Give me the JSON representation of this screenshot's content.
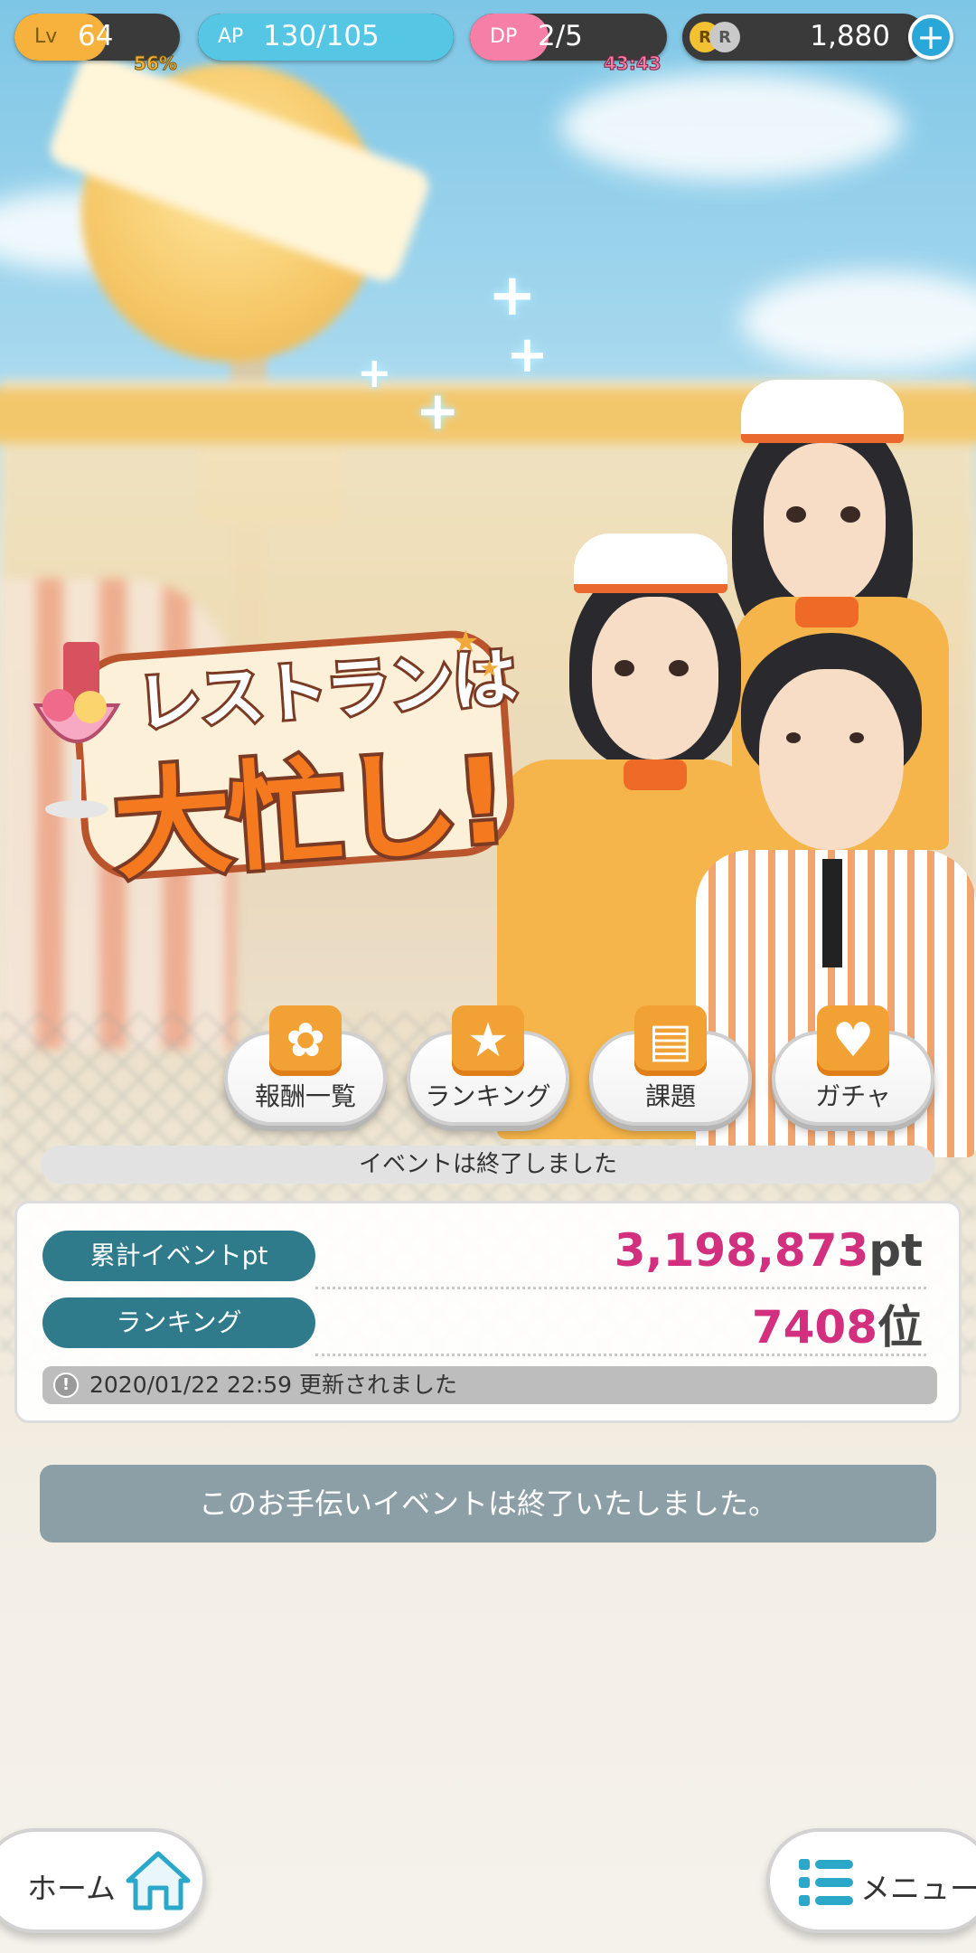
{
  "status_bar": {
    "level_tag": "Lv",
    "level_value": "64",
    "level_progress": "56%",
    "ap_tag": "AP",
    "ap_value": "130/105",
    "dp_tag": "DP",
    "dp_value": "2/5",
    "dp_timer": "43:43",
    "coin_r1": "R",
    "coin_r2": "R",
    "currency_value": "1,880",
    "add_button_symbol": "+"
  },
  "event_logo": {
    "line1": "レストランは",
    "line2": "大忙し!"
  },
  "event_buttons": [
    {
      "label": "報酬一覧",
      "icon": "gift-icon"
    },
    {
      "label": "ランキング",
      "icon": "trophy-icon"
    },
    {
      "label": "課題",
      "icon": "notebook-icon"
    },
    {
      "label": "ガチャ",
      "icon": "heart-card-icon"
    }
  ],
  "event_status": {
    "ended_banner": "イベントは終了しました",
    "stats": [
      {
        "label": "累計イベントpt",
        "value": "3,198,873",
        "unit": "pt"
      },
      {
        "label": "ランキング",
        "value": "7408",
        "unit": "位"
      }
    ],
    "updated_text": "2020/01/22 22:59 更新されました",
    "info_symbol": "!"
  },
  "ended_message": "このお手伝いイベントは終了いたしました。",
  "bottom_nav": {
    "home_label": "ホーム",
    "menu_label": "メニュー"
  },
  "colors": {
    "level_fill": "#f6b23c",
    "ap_fill": "#55c6e4",
    "dp_fill": "#f57fa7",
    "stat_label_bg": "#2f7b8b",
    "stat_value": "#d22f7f",
    "ended_msg_bg": "#8d9fa6"
  }
}
